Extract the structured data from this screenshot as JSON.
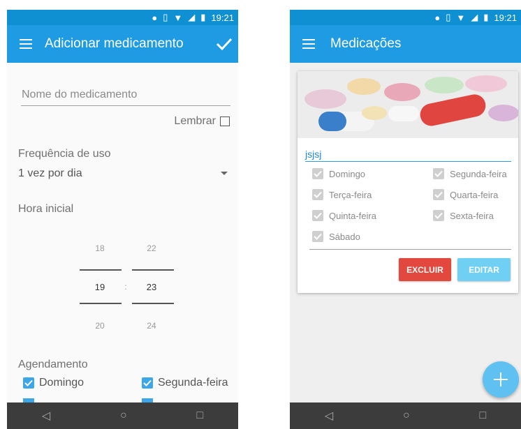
{
  "status": {
    "time": "19:21"
  },
  "left": {
    "title": "Adicionar medicamento",
    "name_placeholder": "Nome do medicamento",
    "remember_label": "Lembrar",
    "frequency_label": "Frequência de uso",
    "frequency_value": "1 vez por dia",
    "start_time_label": "Hora inicial",
    "picker": {
      "hour_prev": "18",
      "hour": "19",
      "hour_next": "20",
      "separator": ":",
      "minute_prev": "22",
      "minute": "23",
      "minute_next": "24"
    },
    "schedule_label": "Agendamento",
    "days": [
      {
        "label": "Domingo",
        "checked": true
      },
      {
        "label": "Segunda-feira",
        "checked": true
      }
    ]
  },
  "right": {
    "title": "Medicações",
    "card": {
      "name": "jsjsj",
      "days": [
        "Domingo",
        "Segunda-feira",
        "Terça-feira",
        "Quarta-feira",
        "Quinta-feira",
        "Sexta-feira",
        "Sábado"
      ],
      "delete_label": "EXCLUIR",
      "edit_label": "EDITAR"
    }
  },
  "colors": {
    "appbar": "#1e9be3",
    "statusbar": "#0f90d3",
    "delete": "#e2483e",
    "edit": "#6fd0f4",
    "fab": "#5ec1f2"
  }
}
